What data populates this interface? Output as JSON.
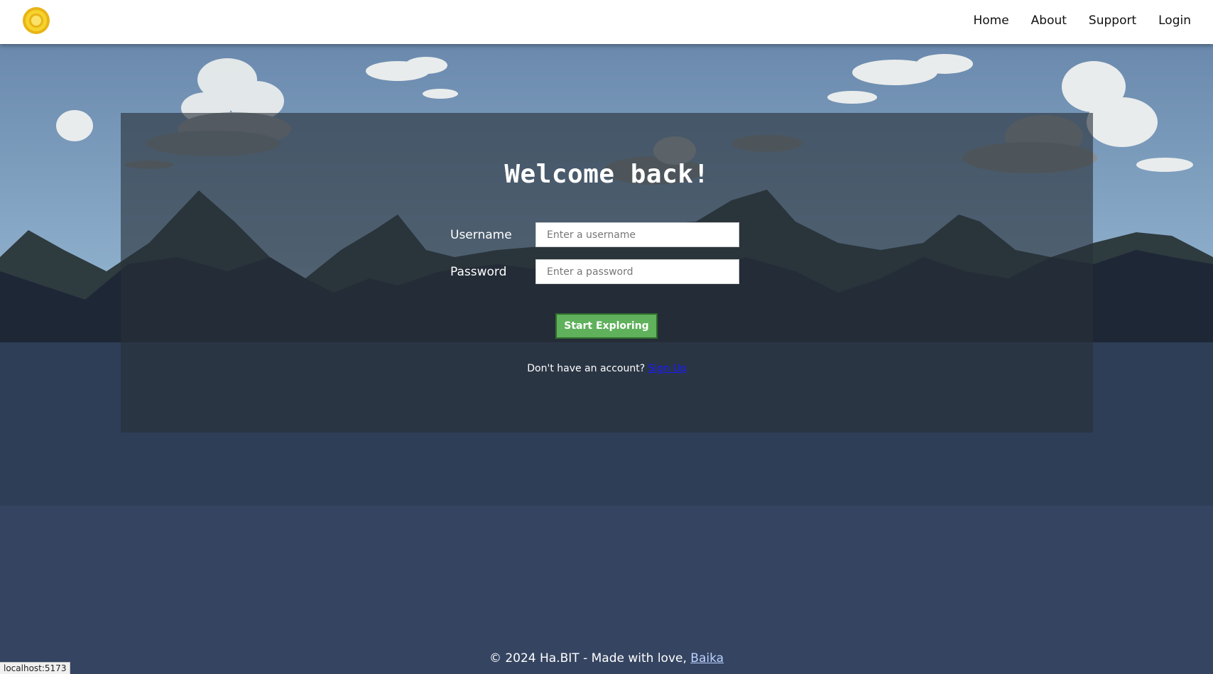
{
  "nav": {
    "logo": "coin-icon",
    "links": [
      "Home",
      "About",
      "Support",
      "Login"
    ]
  },
  "login": {
    "title": "Welcome back!",
    "username_label": "Username",
    "username_placeholder": "Enter a username",
    "password_label": "Password",
    "password_placeholder": "Enter a password",
    "submit_label": "Start Exploring",
    "signup_prompt": "Don't have an account?",
    "signup_link": "Sign Up"
  },
  "footer": {
    "text": "© 2024 Ha.BIT - Made with love,",
    "author_link": "Baika"
  },
  "statusbar": {
    "url": "localhost:5173"
  },
  "colors": {
    "accent_button": "#5fb15b",
    "link": "#1a1aff"
  }
}
